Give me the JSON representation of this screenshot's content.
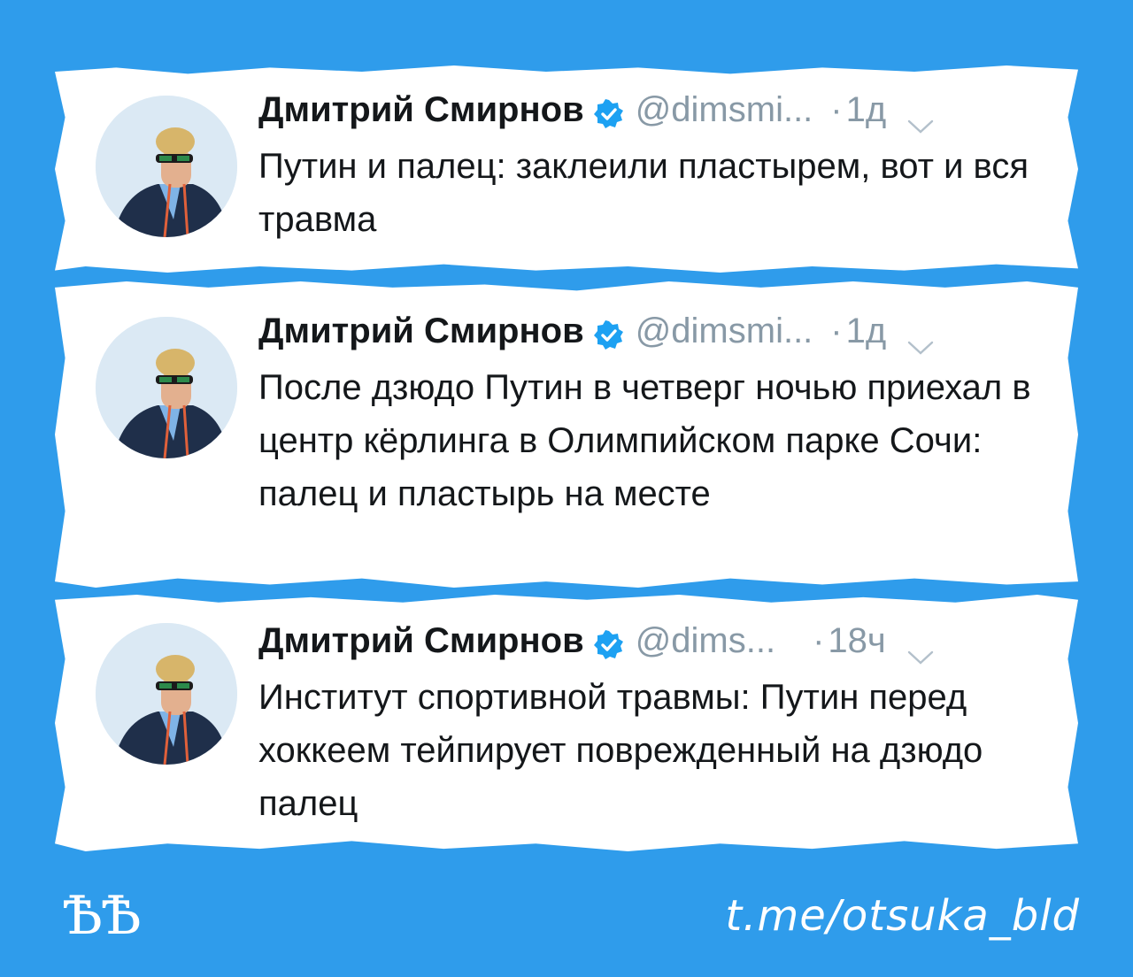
{
  "colors": {
    "background": "#2f9ceb",
    "card": "#ffffff",
    "name": "#14171a",
    "muted": "#8899a6",
    "verified": "#1da1f2"
  },
  "tweets": [
    {
      "name": "Дмитрий Смирнов",
      "handle": "@dimsmi...",
      "dot": "·",
      "time": "1д",
      "text": "Путин и палец: заклеили пластырем, вот и вся травма",
      "icons": [
        "avatar",
        "verified-badge-icon",
        "chevron-down-icon"
      ]
    },
    {
      "name": "Дмитрий Смирнов",
      "handle": "@dimsmi...",
      "dot": "·",
      "time": "1д",
      "text": "После дзюдо Путин в четверг ночью приехал в центр кёрлинга в Олимпийском парке Сочи: палец и пластырь на месте",
      "icons": [
        "avatar",
        "verified-badge-icon",
        "chevron-down-icon"
      ]
    },
    {
      "name": "Дмитрий Смирнов",
      "handle": "@dims...",
      "dot": "·",
      "time": "18ч",
      "text": "Институт спортивной травмы: Путин перед хоккеем тейпирует поврежденный на дзюдо палец",
      "icons": [
        "avatar",
        "verified-badge-icon",
        "chevron-down-icon"
      ]
    }
  ],
  "footer": {
    "logo": "ѢѢ",
    "link": "t.me/otsuka_bld"
  }
}
